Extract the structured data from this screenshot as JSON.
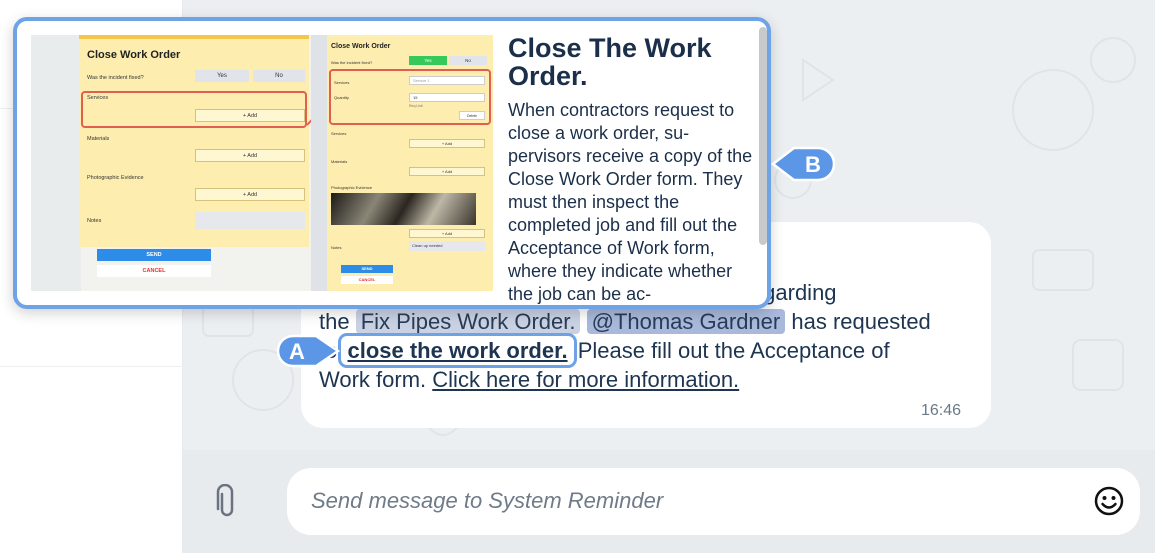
{
  "message": {
    "text_before": "ge regarding",
    "line2_prefix": "the",
    "work_order_chip": "Fix Pipes Work Order.",
    "mention_chip": "@Thomas Gardner",
    "line2_suffix": "has requested",
    "line3_prefix": "to",
    "link_close": "close the work order.",
    "line3_suffix": "Please fill out the Acceptance of",
    "line4_prefix": "Work form.",
    "link_info": "Click here for more information.",
    "time": "16:46"
  },
  "composer": {
    "placeholder": "Send message to System Reminder",
    "attach_icon": "paperclip-icon",
    "emoji_icon": "smiley-icon"
  },
  "card": {
    "title": "Close The Work Order.",
    "body": "When contractors request to close a work order, su- pervisors receive a copy of the Close Work Order form. They must then inspect the completed job and fill out the Acceptance of Work form, where they indicate whether the job can be ac-"
  },
  "preview": {
    "left_form": {
      "title": "Close Work Order",
      "question": "Was the incident fixed?",
      "yes": "Yes",
      "no": "No",
      "services": "Services",
      "materials": "Materials",
      "photo": "Photographic Evidence",
      "notes": "Notes",
      "add": "+ Add",
      "send": "SEND",
      "cancel": "CANCEL"
    },
    "right_form": {
      "title": "Close Work Order",
      "question": "Was the incident fixed?",
      "yes": "Yes",
      "no": "No",
      "services": "Services",
      "service_value": "Service 1",
      "quantity": "Quantity",
      "quantity_value": "15",
      "units": "Req.Unit",
      "delete": "Delete",
      "services2": "Services",
      "materials": "Materials",
      "photo": "Photographic Evidence",
      "notes": "Notes",
      "notes_value": "Clean up needed",
      "add": "+ Add",
      "send": "SEND",
      "cancel": "CANCEL"
    }
  },
  "annotations": {
    "a": "A",
    "b": "B",
    "color": "#5b97e6"
  }
}
